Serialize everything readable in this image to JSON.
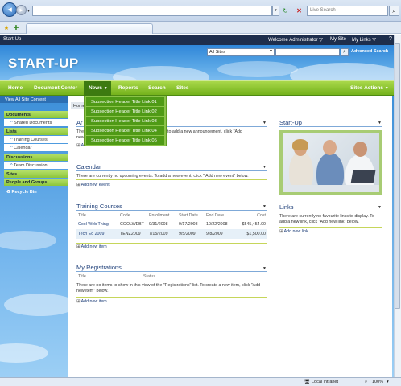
{
  "browser": {
    "search_placeholder": "Live Search",
    "zoom": "100%",
    "zone": "Local intranet"
  },
  "topbar": {
    "site_label": "Start-Up",
    "welcome": "Welcome Administrator ▽",
    "my_site": "My Site",
    "my_links": "My Links ▽"
  },
  "header": {
    "title": "START-UP",
    "scope": "All Sites",
    "advanced_search": "Advanced Search"
  },
  "nav": {
    "tabs": [
      "Home",
      "Document Center",
      "News",
      "Reports",
      "Search",
      "Sites"
    ],
    "site_actions": "Sites Actions"
  },
  "dropdown": {
    "items": [
      "Subsection Header Title Link 01",
      "Subsection Header Title Link 02",
      "Subsection Header Title Link 03",
      "Subsection Header Title Link 04",
      "Subsection Header Title Link 05"
    ]
  },
  "quicklaunch": {
    "view_all": "View All Site Content",
    "documents": "Documents",
    "shared_documents": "Shared Documents",
    "lists": "Lists",
    "training_courses": "Training Courses",
    "calendar": "Calendar",
    "discussions": "Discussions",
    "team_discussion": "Team Discussion",
    "sites": "Sites",
    "people_groups": "People and Groups",
    "recycle_bin": "Recycle Bin"
  },
  "breadcrumb": "Home",
  "announcements": {
    "title": "Ar",
    "text1": "The",
    "text2": "to add a new announcement, click \"Add",
    "text3": "new",
    "add": "Add new announcement"
  },
  "calendar": {
    "title": "Calendar",
    "text": "There are currently no upcoming events. To add a new event, click \" Add new event\" below.",
    "add": "Add new event"
  },
  "training": {
    "title": "Training Courses",
    "columns": [
      "Title",
      "Code",
      "Enrollment",
      "Start Date",
      "End Date",
      "Cost"
    ],
    "rows": [
      [
        "Cool Web Thing",
        "COOLWEBT",
        "9/31/2008",
        "9/17/2008",
        "10/22/2008",
        "$545,454.00"
      ],
      [
        "Tech Ed 2009",
        "TENZ2009",
        "7/15/2009",
        "9/5/2009",
        "9/8/2009",
        "$1,500.00"
      ]
    ],
    "add": "Add new item"
  },
  "registrations": {
    "title": "My Registrations",
    "columns": [
      "Title",
      "Status"
    ],
    "text": "There are no items to show in this view of the \"Registrations\" list. To create a new item, click \"Add new item\" below.",
    "add": "Add new item"
  },
  "startup_panel": {
    "title": "Start-Up"
  },
  "links": {
    "title": "Links",
    "text": "There are currently no favourite links to display. To add a new link, click \"Add new link\" below.",
    "add": "Add new link"
  }
}
